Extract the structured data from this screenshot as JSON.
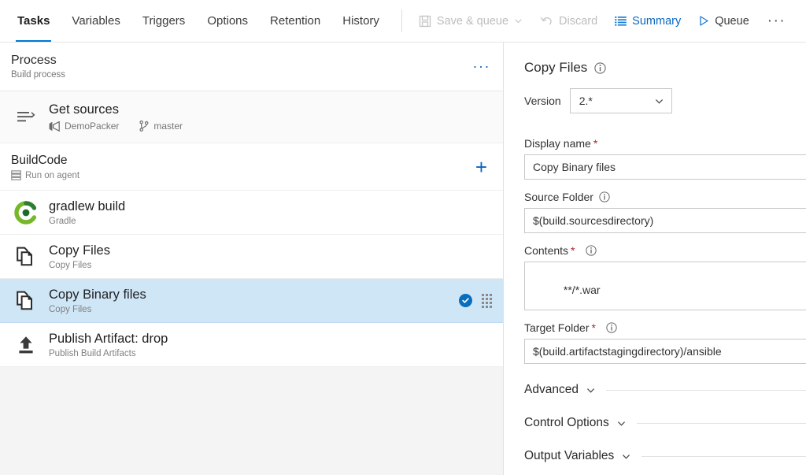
{
  "tabs": [
    {
      "label": "Tasks",
      "active": true
    },
    {
      "label": "Variables",
      "active": false
    },
    {
      "label": "Triggers",
      "active": false
    },
    {
      "label": "Options",
      "active": false
    },
    {
      "label": "Retention",
      "active": false
    },
    {
      "label": "History",
      "active": false
    }
  ],
  "toolbar": {
    "save_queue_label": "Save & queue",
    "discard_label": "Discard",
    "summary_label": "Summary",
    "queue_label": "Queue",
    "overflow_label": "···"
  },
  "process": {
    "title": "Process",
    "subtitle": "Build process",
    "overflow_label": "···"
  },
  "get_sources": {
    "title": "Get sources",
    "repository": "DemoPacker",
    "branch": "master"
  },
  "phase": {
    "title": "BuildCode",
    "subtitle": "Run on agent",
    "add_label": "+"
  },
  "tasks": [
    {
      "title": "gradlew build",
      "subtitle": "Gradle",
      "icon": "gradle-icon",
      "selected": false
    },
    {
      "title": "Copy Files",
      "subtitle": "Copy Files",
      "icon": "copy-files-icon",
      "selected": false
    },
    {
      "title": "Copy Binary files",
      "subtitle": "Copy Files",
      "icon": "copy-files-icon",
      "selected": true
    },
    {
      "title": "Publish Artifact: drop",
      "subtitle": "Publish Build Artifacts",
      "icon": "publish-artifact-icon",
      "selected": false
    }
  ],
  "details": {
    "title": "Copy Files",
    "version_label": "Version",
    "version_value": "2.*",
    "fields": {
      "display_name": {
        "label": "Display name",
        "required": true,
        "value": "Copy Binary files"
      },
      "source_folder": {
        "label": "Source Folder",
        "required": false,
        "value": "$(build.sourcesdirectory)"
      },
      "contents": {
        "label": "Contents",
        "required": true,
        "value": "**/*.war"
      },
      "target_folder": {
        "label": "Target Folder",
        "required": true,
        "value": "$(build.artifactstagingdirectory)/ansible"
      }
    },
    "sections": [
      {
        "label": "Advanced"
      },
      {
        "label": "Control Options"
      },
      {
        "label": "Output Variables"
      }
    ]
  },
  "colors": {
    "accent_blue": "#0078d4",
    "link_blue": "#0a66bd",
    "selected_row_bg": "#cfe6f7",
    "required_red": "#b4232a",
    "gradle_green": "#6aae2a"
  }
}
